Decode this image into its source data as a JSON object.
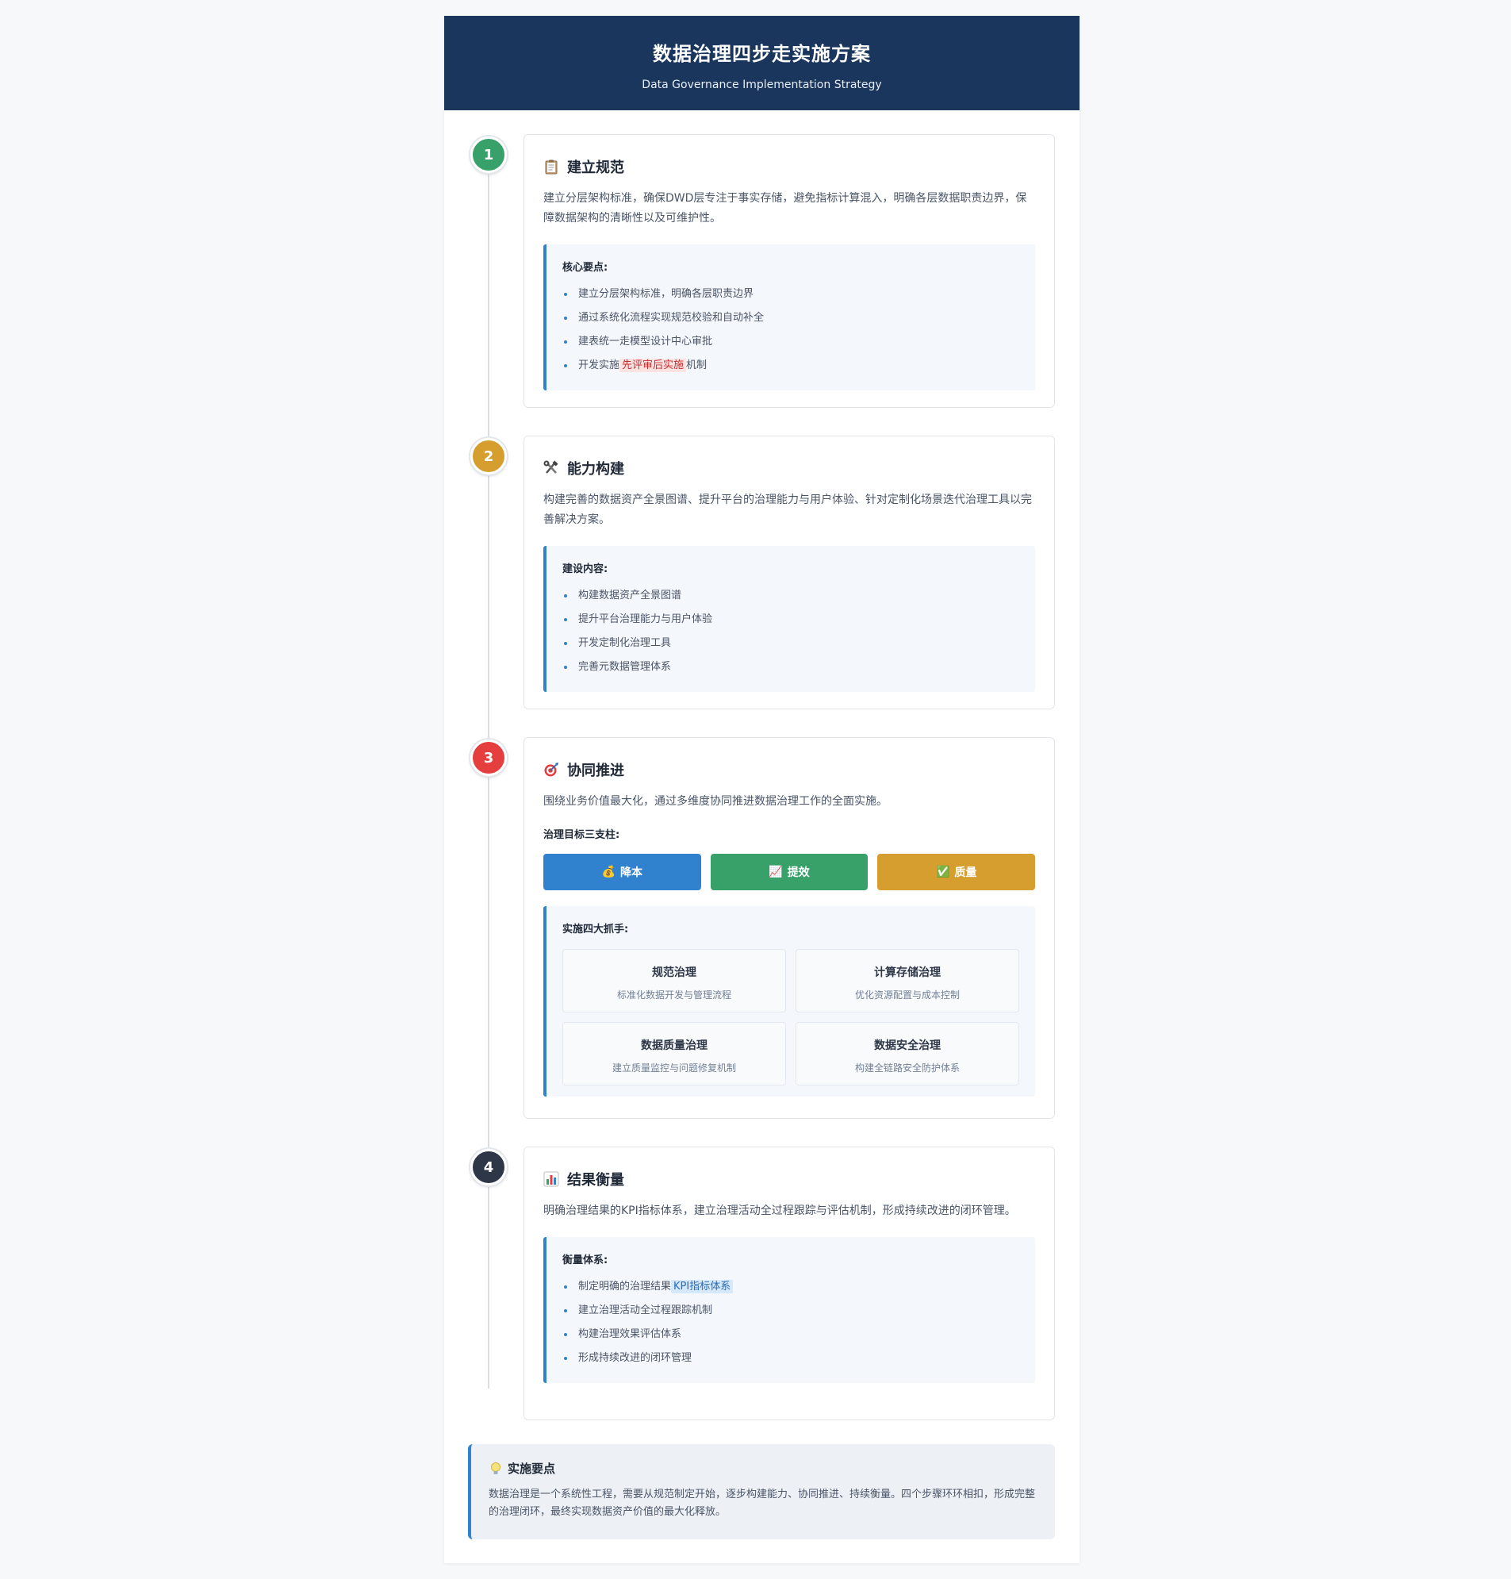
{
  "header": {
    "title": "数据治理四步走实施方案",
    "subtitle": "Data Governance Implementation Strategy"
  },
  "steps": [
    {
      "number": "1",
      "color": "#38a169",
      "icon": "clipboard-icon",
      "title": "建立规范",
      "description": "建立分层架构标准，确保DWD层专注于事实存储，避免指标计算混入，明确各层数据职责边界，保障数据架构的清晰性以及可维护性。",
      "box_title": "核心要点:",
      "items": [
        "建立分层架构标准，明确各层职责边界",
        "通过系统化流程实现规范校验和自动补全",
        "建表统一走模型设计中心审批"
      ],
      "last_item_prefix": "开发实施",
      "last_item_highlight": "先评审后实施",
      "last_item_suffix": "机制"
    },
    {
      "number": "2",
      "color": "#d69e2e",
      "icon": "tools-icon",
      "title": "能力构建",
      "description": "构建完善的数据资产全景图谱、提升平台的治理能力与用户体验、针对定制化场景迭代治理工具以完善解决方案。",
      "box_title": "建设内容:",
      "items": [
        "构建数据资产全景图谱",
        "提升平台治理能力与用户体验",
        "开发定制化治理工具",
        "完善元数据管理体系"
      ]
    },
    {
      "number": "3",
      "color": "#e53e3e",
      "icon": "target-icon",
      "title": "协同推进",
      "description": "围绕业务价值最大化，通过多维度协同推进数据治理工作的全面实施。",
      "pillars_label": "治理目标三支柱:",
      "pillars": [
        {
          "label": "降本",
          "icon": "money-bag-icon",
          "glyph": "💰",
          "color": "#3182ce"
        },
        {
          "label": "提效",
          "icon": "chart-up-icon",
          "glyph": "📈",
          "color": "#38a169"
        },
        {
          "label": "质量",
          "icon": "check-icon",
          "glyph": "✅",
          "color": "#d69e2e"
        }
      ],
      "box_title": "实施四大抓手:",
      "grid": [
        {
          "title": "规范治理",
          "desc": "标准化数据开发与管理流程"
        },
        {
          "title": "计算存储治理",
          "desc": "优化资源配置与成本控制"
        },
        {
          "title": "数据质量治理",
          "desc": "建立质量监控与问题修复机制"
        },
        {
          "title": "数据安全治理",
          "desc": "构建全链路安全防护体系"
        }
      ]
    },
    {
      "number": "4",
      "color": "#2d3748",
      "icon": "bar-chart-icon",
      "title": "结果衡量",
      "description": "明确治理结果的KPI指标体系，建立治理活动全过程跟踪与评估机制，形成持续改进的闭环管理。",
      "box_title": "衡量体系:",
      "first_item_prefix": "制定明确的治理结果",
      "first_item_highlight": "KPI指标体系",
      "items": [
        "建立治理活动全过程跟踪机制",
        "构建治理效果评估体系",
        "形成持续改进的闭环管理"
      ]
    }
  ],
  "summary": {
    "icon": "lightbulb-icon",
    "title": "实施要点",
    "text": "数据治理是一个系统性工程，需要从规范制定开始，逐步构建能力、协同推进、持续衡量。四个步骤环环相扣，形成完整的治理闭环，最终实现数据资产价值的最大化释放。"
  },
  "colors": {
    "header_bg": "#1b365d",
    "accent": "#3182ce"
  }
}
